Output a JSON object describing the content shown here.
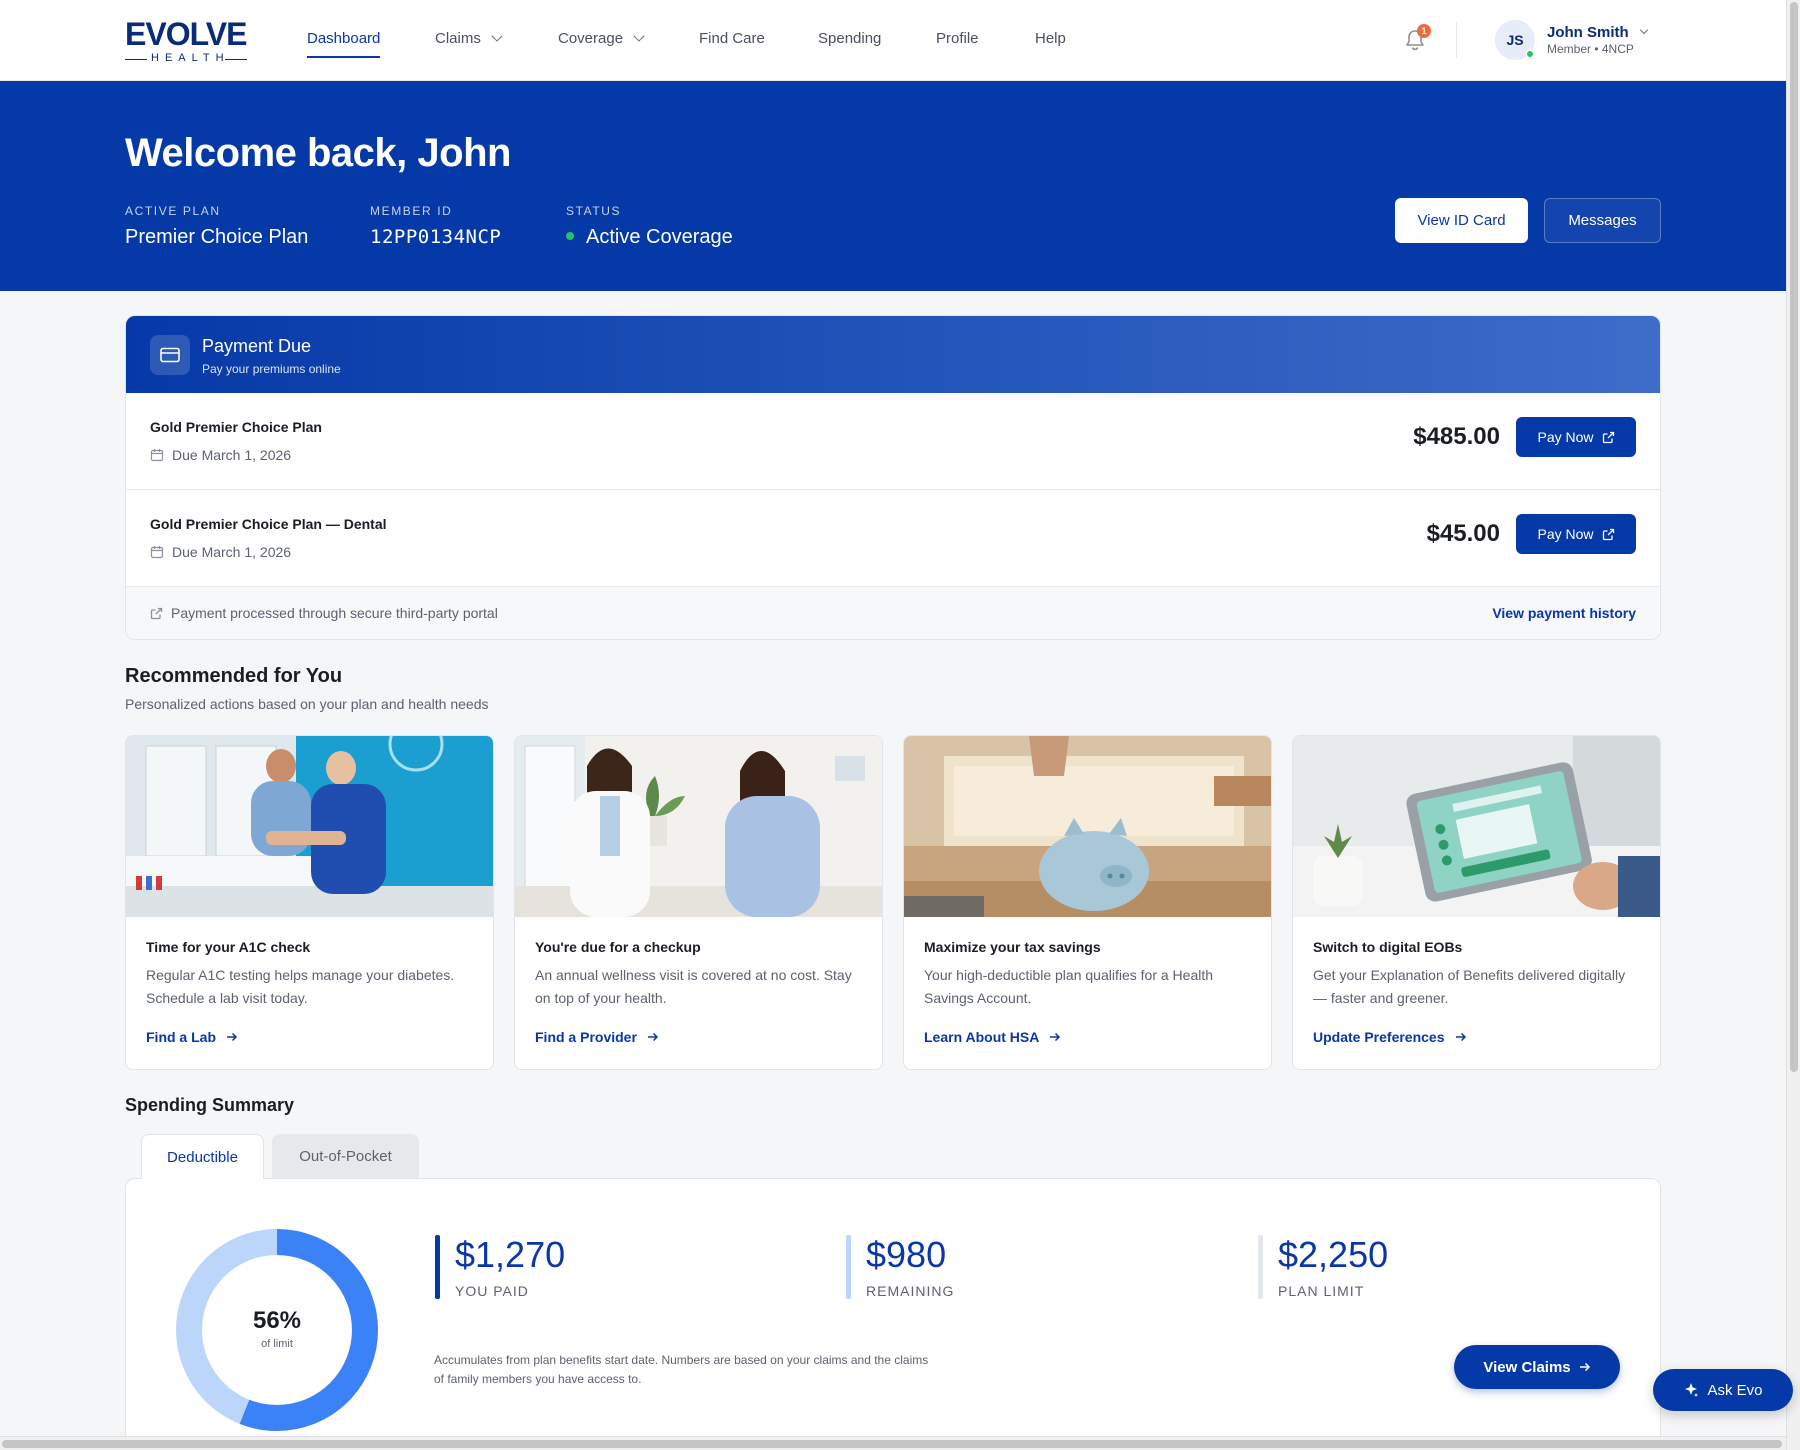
{
  "nav": {
    "logo_top": "EVOLVE",
    "logo_bottom": "HEALTH",
    "items": [
      {
        "label": "Dashboard",
        "active": true,
        "dropdown": false
      },
      {
        "label": "Claims",
        "active": false,
        "dropdown": true
      },
      {
        "label": "Coverage",
        "active": false,
        "dropdown": true
      },
      {
        "label": "Find Care",
        "active": false,
        "dropdown": false
      },
      {
        "label": "Spending",
        "active": false,
        "dropdown": false
      },
      {
        "label": "Profile",
        "active": false,
        "dropdown": false
      },
      {
        "label": "Help",
        "active": false,
        "dropdown": false
      }
    ],
    "notification_count": "1",
    "user": {
      "initials": "JS",
      "name": "John Smith",
      "sub": "Member • 4NCP"
    }
  },
  "hero": {
    "title": "Welcome back, John",
    "plan_label": "ACTIVE PLAN",
    "plan_value": "Premier Choice Plan",
    "member_label": "MEMBER ID",
    "member_value": "12PP0134NCP",
    "status_label": "STATUS",
    "status_value": "Active Coverage",
    "id_card_button": "View ID Card",
    "messages_button": "Messages"
  },
  "payment": {
    "title": "Payment Due",
    "subtitle": "Pay your premiums online",
    "rows": [
      {
        "name": "Gold Premier Choice Plan",
        "due": "Due March 1, 2026",
        "amount": "$485.00",
        "button": "Pay Now"
      },
      {
        "name": "Gold Premier Choice Plan — Dental",
        "due": "Due March 1, 2026",
        "amount": "$45.00",
        "button": "Pay Now"
      }
    ],
    "footer_note": "Payment processed through secure third-party portal",
    "history_link": "View payment history"
  },
  "recommended": {
    "title": "Recommended for You",
    "subtitle": "Personalized actions based on your plan and health needs",
    "cards": [
      {
        "title": "Time for your A1C check",
        "desc": "Regular A1C testing helps manage your diabetes. Schedule a lab visit today.",
        "link": "Find a Lab"
      },
      {
        "title": "You're due for a checkup",
        "desc": "An annual wellness visit is covered at no cost. Stay on top of your health.",
        "link": "Find a Provider"
      },
      {
        "title": "Maximize your tax savings",
        "desc": "Your high-deductible plan qualifies for a Health Savings Account.",
        "link": "Learn About HSA"
      },
      {
        "title": "Switch to digital EOBs",
        "desc": "Get your Explanation of Benefits delivered digitally — faster and greener.",
        "link": "Update Preferences"
      }
    ]
  },
  "spending": {
    "title": "Spending Summary",
    "tabs": [
      "Deductible",
      "Out-of-Pocket"
    ],
    "percent": "56%",
    "percent_sub": "of limit",
    "percent_value": 0.56,
    "stats": [
      {
        "value": "$1,270",
        "label": "YOU PAID"
      },
      {
        "value": "$980",
        "label": "REMAINING"
      },
      {
        "value": "$2,250",
        "label": "PLAN LIMIT"
      }
    ],
    "note": "Accumulates from plan benefits start date. Numbers are based on your claims and the claims of family members you have access to.",
    "claims_button": "View Claims"
  },
  "assistant_button": "Ask Evo",
  "colors": {
    "brand": "#0639a8",
    "accent_light": "#bcd6fb",
    "donut_fill": "#3b82f6",
    "status_green": "#22c55e",
    "badge": "#f06a3c"
  }
}
